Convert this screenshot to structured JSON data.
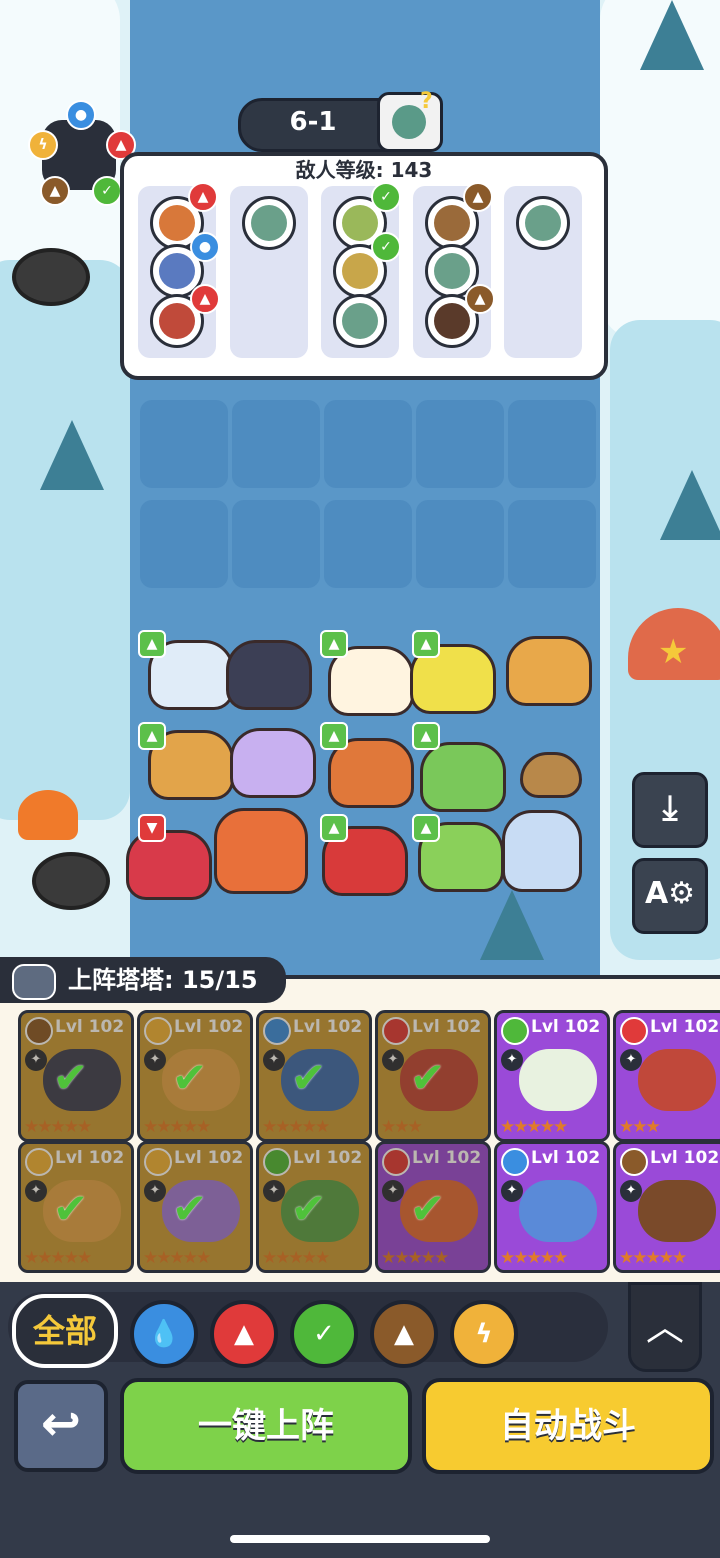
{
  "stage": {
    "label": "6-1",
    "boss_icon": "zombie-boss-icon"
  },
  "enemy": {
    "level_text": "敌人等级: 143",
    "lanes": [
      {
        "enemies": [
          {
            "icon": "lion-zombie",
            "element": "fire"
          },
          {
            "icon": "blue-zombie",
            "element": "water"
          },
          {
            "icon": "red-zombie",
            "element": "fire"
          }
        ]
      },
      {
        "enemies": [
          {
            "icon": "green-zombie",
            "element": ""
          }
        ]
      },
      {
        "enemies": [
          {
            "icon": "plant-zombie",
            "element": "grass"
          },
          {
            "icon": "lion-zombie",
            "element": "grass"
          },
          {
            "icon": "green-zombie",
            "element": ""
          }
        ]
      },
      {
        "enemies": [
          {
            "icon": "brown-zombie",
            "element": "earth"
          },
          {
            "icon": "green-zombie",
            "element": ""
          },
          {
            "icon": "brown-zombie",
            "element": "earth"
          }
        ]
      },
      {
        "enemies": [
          {
            "icon": "green-zombie",
            "element": ""
          }
        ]
      }
    ]
  },
  "roster": {
    "title": "上阵塔塔: 15/15",
    "level_label": "Lvl 102",
    "cards": [
      {
        "element": "earth",
        "color": "#c89a3a",
        "pet_color": "#3c3f55",
        "deployed": true,
        "stars": "★★★★★"
      },
      {
        "element": "thunder",
        "color": "#c89a3a",
        "pet_color": "#e2a44a",
        "deployed": true,
        "stars": "★★★★★"
      },
      {
        "element": "water",
        "color": "#c89a3a",
        "pet_color": "#3c6cb0",
        "deployed": true,
        "stars": "★★★★★"
      },
      {
        "element": "fire",
        "color": "#c89a3a",
        "pet_color": "#c0483a",
        "deployed": true,
        "stars": "★★★"
      },
      {
        "element": "grass",
        "color": "#9a4ad8",
        "pet_color": "#e8f2e0",
        "deployed": false,
        "stars": "★★★★★"
      },
      {
        "element": "fire",
        "color": "#9a4ad8",
        "pet_color": "#c0483a",
        "deployed": false,
        "stars": "★★★"
      },
      {
        "element": "thunder",
        "color": "#c89a3a",
        "pet_color": "#e2a44a",
        "deployed": true,
        "stars": "★★★★★"
      },
      {
        "element": "thunder",
        "color": "#c89a3a",
        "pet_color": "#a07ad8",
        "deployed": true,
        "stars": "★★★★★"
      },
      {
        "element": "grass",
        "color": "#c89a3a",
        "pet_color": "#5aa04a",
        "deployed": true,
        "stars": "★★★★★"
      },
      {
        "element": "fire",
        "color": "#9a4ad8",
        "pet_color": "#e06a3a",
        "deployed": true,
        "stars": "★★★★★"
      },
      {
        "element": "water",
        "color": "#9a4ad8",
        "pet_color": "#5a8ad8",
        "deployed": false,
        "stars": "★★★★★"
      },
      {
        "element": "earth",
        "color": "#9a4ad8",
        "pet_color": "#7a4a2a",
        "deployed": false,
        "stars": "★★★★★"
      }
    ]
  },
  "filters": {
    "all_label": "全部",
    "elements": [
      "water",
      "fire",
      "grass",
      "earth",
      "thunder"
    ]
  },
  "actions": {
    "deploy_label": "一键上阵",
    "auto_battle_label": "自动战斗"
  },
  "colors": {
    "water": "#3a8ee0",
    "fire": "#e03a3a",
    "grass": "#4fb83a",
    "earth": "#8a5a2a",
    "thunder": "#f0b23a",
    "accent": "#f5c93a"
  }
}
